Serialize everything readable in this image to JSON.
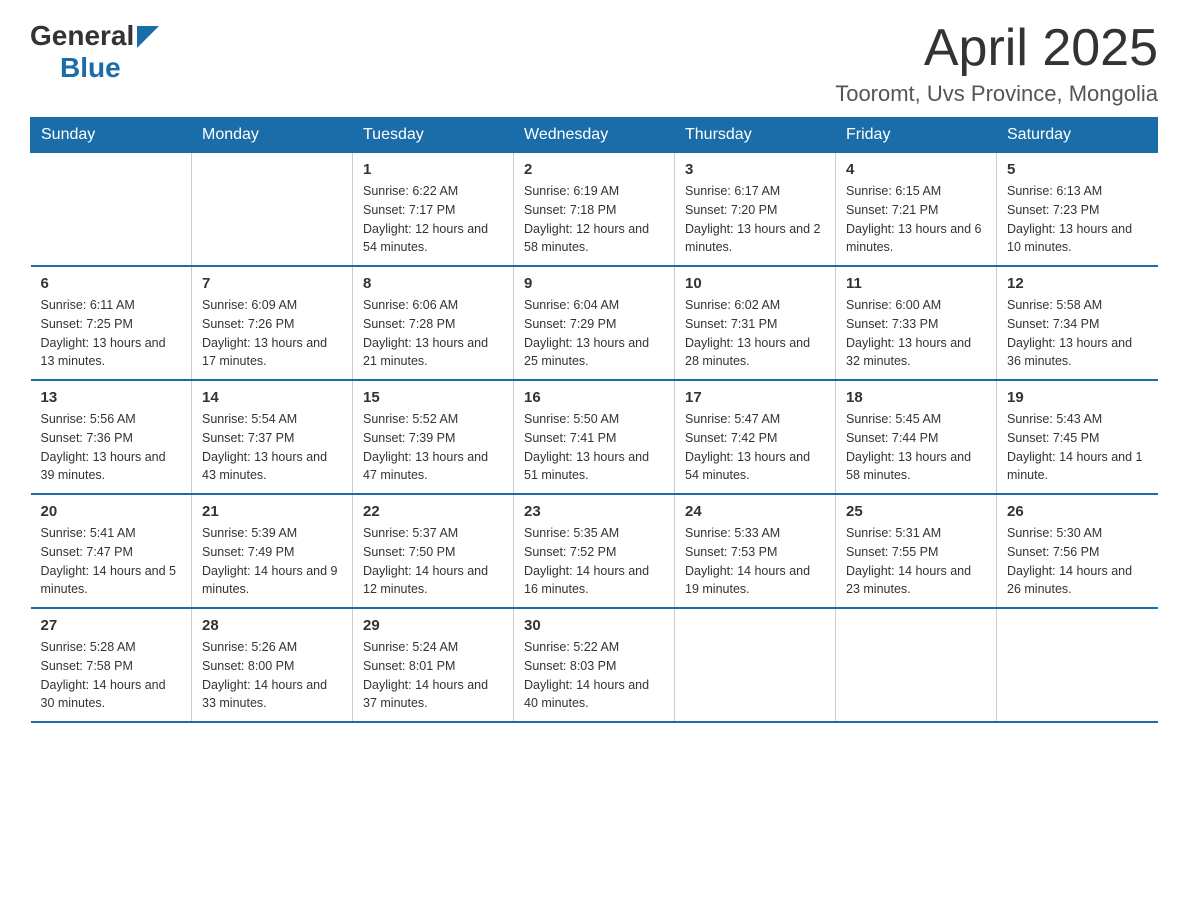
{
  "header": {
    "logo_general": "General",
    "logo_blue": "Blue",
    "month_title": "April 2025",
    "location": "Tooromt, Uvs Province, Mongolia"
  },
  "weekdays": [
    "Sunday",
    "Monday",
    "Tuesday",
    "Wednesday",
    "Thursday",
    "Friday",
    "Saturday"
  ],
  "weeks": [
    [
      {
        "day": "",
        "sunrise": "",
        "sunset": "",
        "daylight": ""
      },
      {
        "day": "",
        "sunrise": "",
        "sunset": "",
        "daylight": ""
      },
      {
        "day": "1",
        "sunrise": "Sunrise: 6:22 AM",
        "sunset": "Sunset: 7:17 PM",
        "daylight": "Daylight: 12 hours and 54 minutes."
      },
      {
        "day": "2",
        "sunrise": "Sunrise: 6:19 AM",
        "sunset": "Sunset: 7:18 PM",
        "daylight": "Daylight: 12 hours and 58 minutes."
      },
      {
        "day": "3",
        "sunrise": "Sunrise: 6:17 AM",
        "sunset": "Sunset: 7:20 PM",
        "daylight": "Daylight: 13 hours and 2 minutes."
      },
      {
        "day": "4",
        "sunrise": "Sunrise: 6:15 AM",
        "sunset": "Sunset: 7:21 PM",
        "daylight": "Daylight: 13 hours and 6 minutes."
      },
      {
        "day": "5",
        "sunrise": "Sunrise: 6:13 AM",
        "sunset": "Sunset: 7:23 PM",
        "daylight": "Daylight: 13 hours and 10 minutes."
      }
    ],
    [
      {
        "day": "6",
        "sunrise": "Sunrise: 6:11 AM",
        "sunset": "Sunset: 7:25 PM",
        "daylight": "Daylight: 13 hours and 13 minutes."
      },
      {
        "day": "7",
        "sunrise": "Sunrise: 6:09 AM",
        "sunset": "Sunset: 7:26 PM",
        "daylight": "Daylight: 13 hours and 17 minutes."
      },
      {
        "day": "8",
        "sunrise": "Sunrise: 6:06 AM",
        "sunset": "Sunset: 7:28 PM",
        "daylight": "Daylight: 13 hours and 21 minutes."
      },
      {
        "day": "9",
        "sunrise": "Sunrise: 6:04 AM",
        "sunset": "Sunset: 7:29 PM",
        "daylight": "Daylight: 13 hours and 25 minutes."
      },
      {
        "day": "10",
        "sunrise": "Sunrise: 6:02 AM",
        "sunset": "Sunset: 7:31 PM",
        "daylight": "Daylight: 13 hours and 28 minutes."
      },
      {
        "day": "11",
        "sunrise": "Sunrise: 6:00 AM",
        "sunset": "Sunset: 7:33 PM",
        "daylight": "Daylight: 13 hours and 32 minutes."
      },
      {
        "day": "12",
        "sunrise": "Sunrise: 5:58 AM",
        "sunset": "Sunset: 7:34 PM",
        "daylight": "Daylight: 13 hours and 36 minutes."
      }
    ],
    [
      {
        "day": "13",
        "sunrise": "Sunrise: 5:56 AM",
        "sunset": "Sunset: 7:36 PM",
        "daylight": "Daylight: 13 hours and 39 minutes."
      },
      {
        "day": "14",
        "sunrise": "Sunrise: 5:54 AM",
        "sunset": "Sunset: 7:37 PM",
        "daylight": "Daylight: 13 hours and 43 minutes."
      },
      {
        "day": "15",
        "sunrise": "Sunrise: 5:52 AM",
        "sunset": "Sunset: 7:39 PM",
        "daylight": "Daylight: 13 hours and 47 minutes."
      },
      {
        "day": "16",
        "sunrise": "Sunrise: 5:50 AM",
        "sunset": "Sunset: 7:41 PM",
        "daylight": "Daylight: 13 hours and 51 minutes."
      },
      {
        "day": "17",
        "sunrise": "Sunrise: 5:47 AM",
        "sunset": "Sunset: 7:42 PM",
        "daylight": "Daylight: 13 hours and 54 minutes."
      },
      {
        "day": "18",
        "sunrise": "Sunrise: 5:45 AM",
        "sunset": "Sunset: 7:44 PM",
        "daylight": "Daylight: 13 hours and 58 minutes."
      },
      {
        "day": "19",
        "sunrise": "Sunrise: 5:43 AM",
        "sunset": "Sunset: 7:45 PM",
        "daylight": "Daylight: 14 hours and 1 minute."
      }
    ],
    [
      {
        "day": "20",
        "sunrise": "Sunrise: 5:41 AM",
        "sunset": "Sunset: 7:47 PM",
        "daylight": "Daylight: 14 hours and 5 minutes."
      },
      {
        "day": "21",
        "sunrise": "Sunrise: 5:39 AM",
        "sunset": "Sunset: 7:49 PM",
        "daylight": "Daylight: 14 hours and 9 minutes."
      },
      {
        "day": "22",
        "sunrise": "Sunrise: 5:37 AM",
        "sunset": "Sunset: 7:50 PM",
        "daylight": "Daylight: 14 hours and 12 minutes."
      },
      {
        "day": "23",
        "sunrise": "Sunrise: 5:35 AM",
        "sunset": "Sunset: 7:52 PM",
        "daylight": "Daylight: 14 hours and 16 minutes."
      },
      {
        "day": "24",
        "sunrise": "Sunrise: 5:33 AM",
        "sunset": "Sunset: 7:53 PM",
        "daylight": "Daylight: 14 hours and 19 minutes."
      },
      {
        "day": "25",
        "sunrise": "Sunrise: 5:31 AM",
        "sunset": "Sunset: 7:55 PM",
        "daylight": "Daylight: 14 hours and 23 minutes."
      },
      {
        "day": "26",
        "sunrise": "Sunrise: 5:30 AM",
        "sunset": "Sunset: 7:56 PM",
        "daylight": "Daylight: 14 hours and 26 minutes."
      }
    ],
    [
      {
        "day": "27",
        "sunrise": "Sunrise: 5:28 AM",
        "sunset": "Sunset: 7:58 PM",
        "daylight": "Daylight: 14 hours and 30 minutes."
      },
      {
        "day": "28",
        "sunrise": "Sunrise: 5:26 AM",
        "sunset": "Sunset: 8:00 PM",
        "daylight": "Daylight: 14 hours and 33 minutes."
      },
      {
        "day": "29",
        "sunrise": "Sunrise: 5:24 AM",
        "sunset": "Sunset: 8:01 PM",
        "daylight": "Daylight: 14 hours and 37 minutes."
      },
      {
        "day": "30",
        "sunrise": "Sunrise: 5:22 AM",
        "sunset": "Sunset: 8:03 PM",
        "daylight": "Daylight: 14 hours and 40 minutes."
      },
      {
        "day": "",
        "sunrise": "",
        "sunset": "",
        "daylight": ""
      },
      {
        "day": "",
        "sunrise": "",
        "sunset": "",
        "daylight": ""
      },
      {
        "day": "",
        "sunrise": "",
        "sunset": "",
        "daylight": ""
      }
    ]
  ]
}
